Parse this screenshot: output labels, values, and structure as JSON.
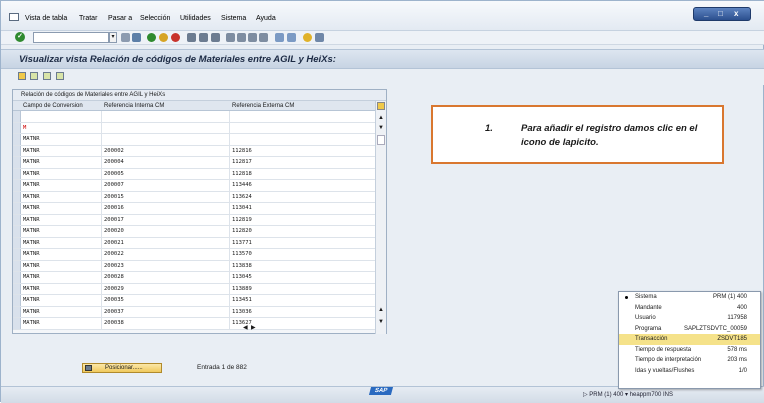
{
  "menu": [
    {
      "label": "Vista de tabla"
    },
    {
      "label": "Tratar"
    },
    {
      "label": "Pasar a"
    },
    {
      "label": "Selección"
    },
    {
      "label": "Utilidades"
    },
    {
      "label": "Sistema"
    },
    {
      "label": "Ayuda"
    }
  ],
  "window_controls": {
    "minimize": "_",
    "restore": "□",
    "close": "x"
  },
  "toolbar": {
    "command_value": "",
    "check_icon": "check-icon"
  },
  "page_title": "Visualizar vista Relación de códigos de Materiales entre AGIL y HeiXs:",
  "table": {
    "title": "Relación de códigos de Materiales entre AGIL y HeiXs",
    "columns": [
      "Campo de Conversion",
      "Referencia Interna CM",
      "Referencia Externa CM"
    ],
    "rows": [
      [
        "",
        "",
        ""
      ],
      [
        "M",
        "",
        ""
      ],
      [
        "MATNR",
        "",
        ""
      ],
      [
        "MATNR",
        "200002",
        "112816"
      ],
      [
        "MATNR",
        "200004",
        "112817"
      ],
      [
        "MATNR",
        "200005",
        "112818"
      ],
      [
        "MATNR",
        "200007",
        "113446"
      ],
      [
        "MATNR",
        "200015",
        "113624"
      ],
      [
        "MATNR",
        "200016",
        "113041"
      ],
      [
        "MATNR",
        "200017",
        "112819"
      ],
      [
        "MATNR",
        "200020",
        "112820"
      ],
      [
        "MATNR",
        "200021",
        "113771"
      ],
      [
        "MATNR",
        "200022",
        "113570"
      ],
      [
        "MATNR",
        "200023",
        "113838"
      ],
      [
        "MATNR",
        "200028",
        "113045"
      ],
      [
        "MATNR",
        "200029",
        "113889"
      ],
      [
        "MATNR",
        "200035",
        "113451"
      ],
      [
        "MATNR",
        "200037",
        "113036"
      ],
      [
        "MATNR",
        "200038",
        "113627"
      ]
    ]
  },
  "callout": {
    "number": "1.",
    "text": "Para añadir el registro damos clic en el icono de lapicito."
  },
  "position_button": "Posicionar......",
  "entry_text": "Entrada 1 de 882",
  "sap_logo": "SAP",
  "status_text": "PRM (1) 400",
  "status_extra": "heappm700  INS",
  "system_popup": [
    {
      "key": "Sistema",
      "value": "PRM (1) 400"
    },
    {
      "key": "Mandante",
      "value": "400"
    },
    {
      "key": "Usuario",
      "value": "117958"
    },
    {
      "key": "Programa",
      "value": "SAPLZTSDVTC_00059"
    },
    {
      "key": "Transacción",
      "value": "ZSDVT185"
    },
    {
      "key": "Tiempo de respuesta",
      "value": "578 ms"
    },
    {
      "key": "Tiempo de interpretación",
      "value": "203 ms"
    },
    {
      "key": "Idas y vueltas/Flushes",
      "value": "1/0"
    }
  ]
}
